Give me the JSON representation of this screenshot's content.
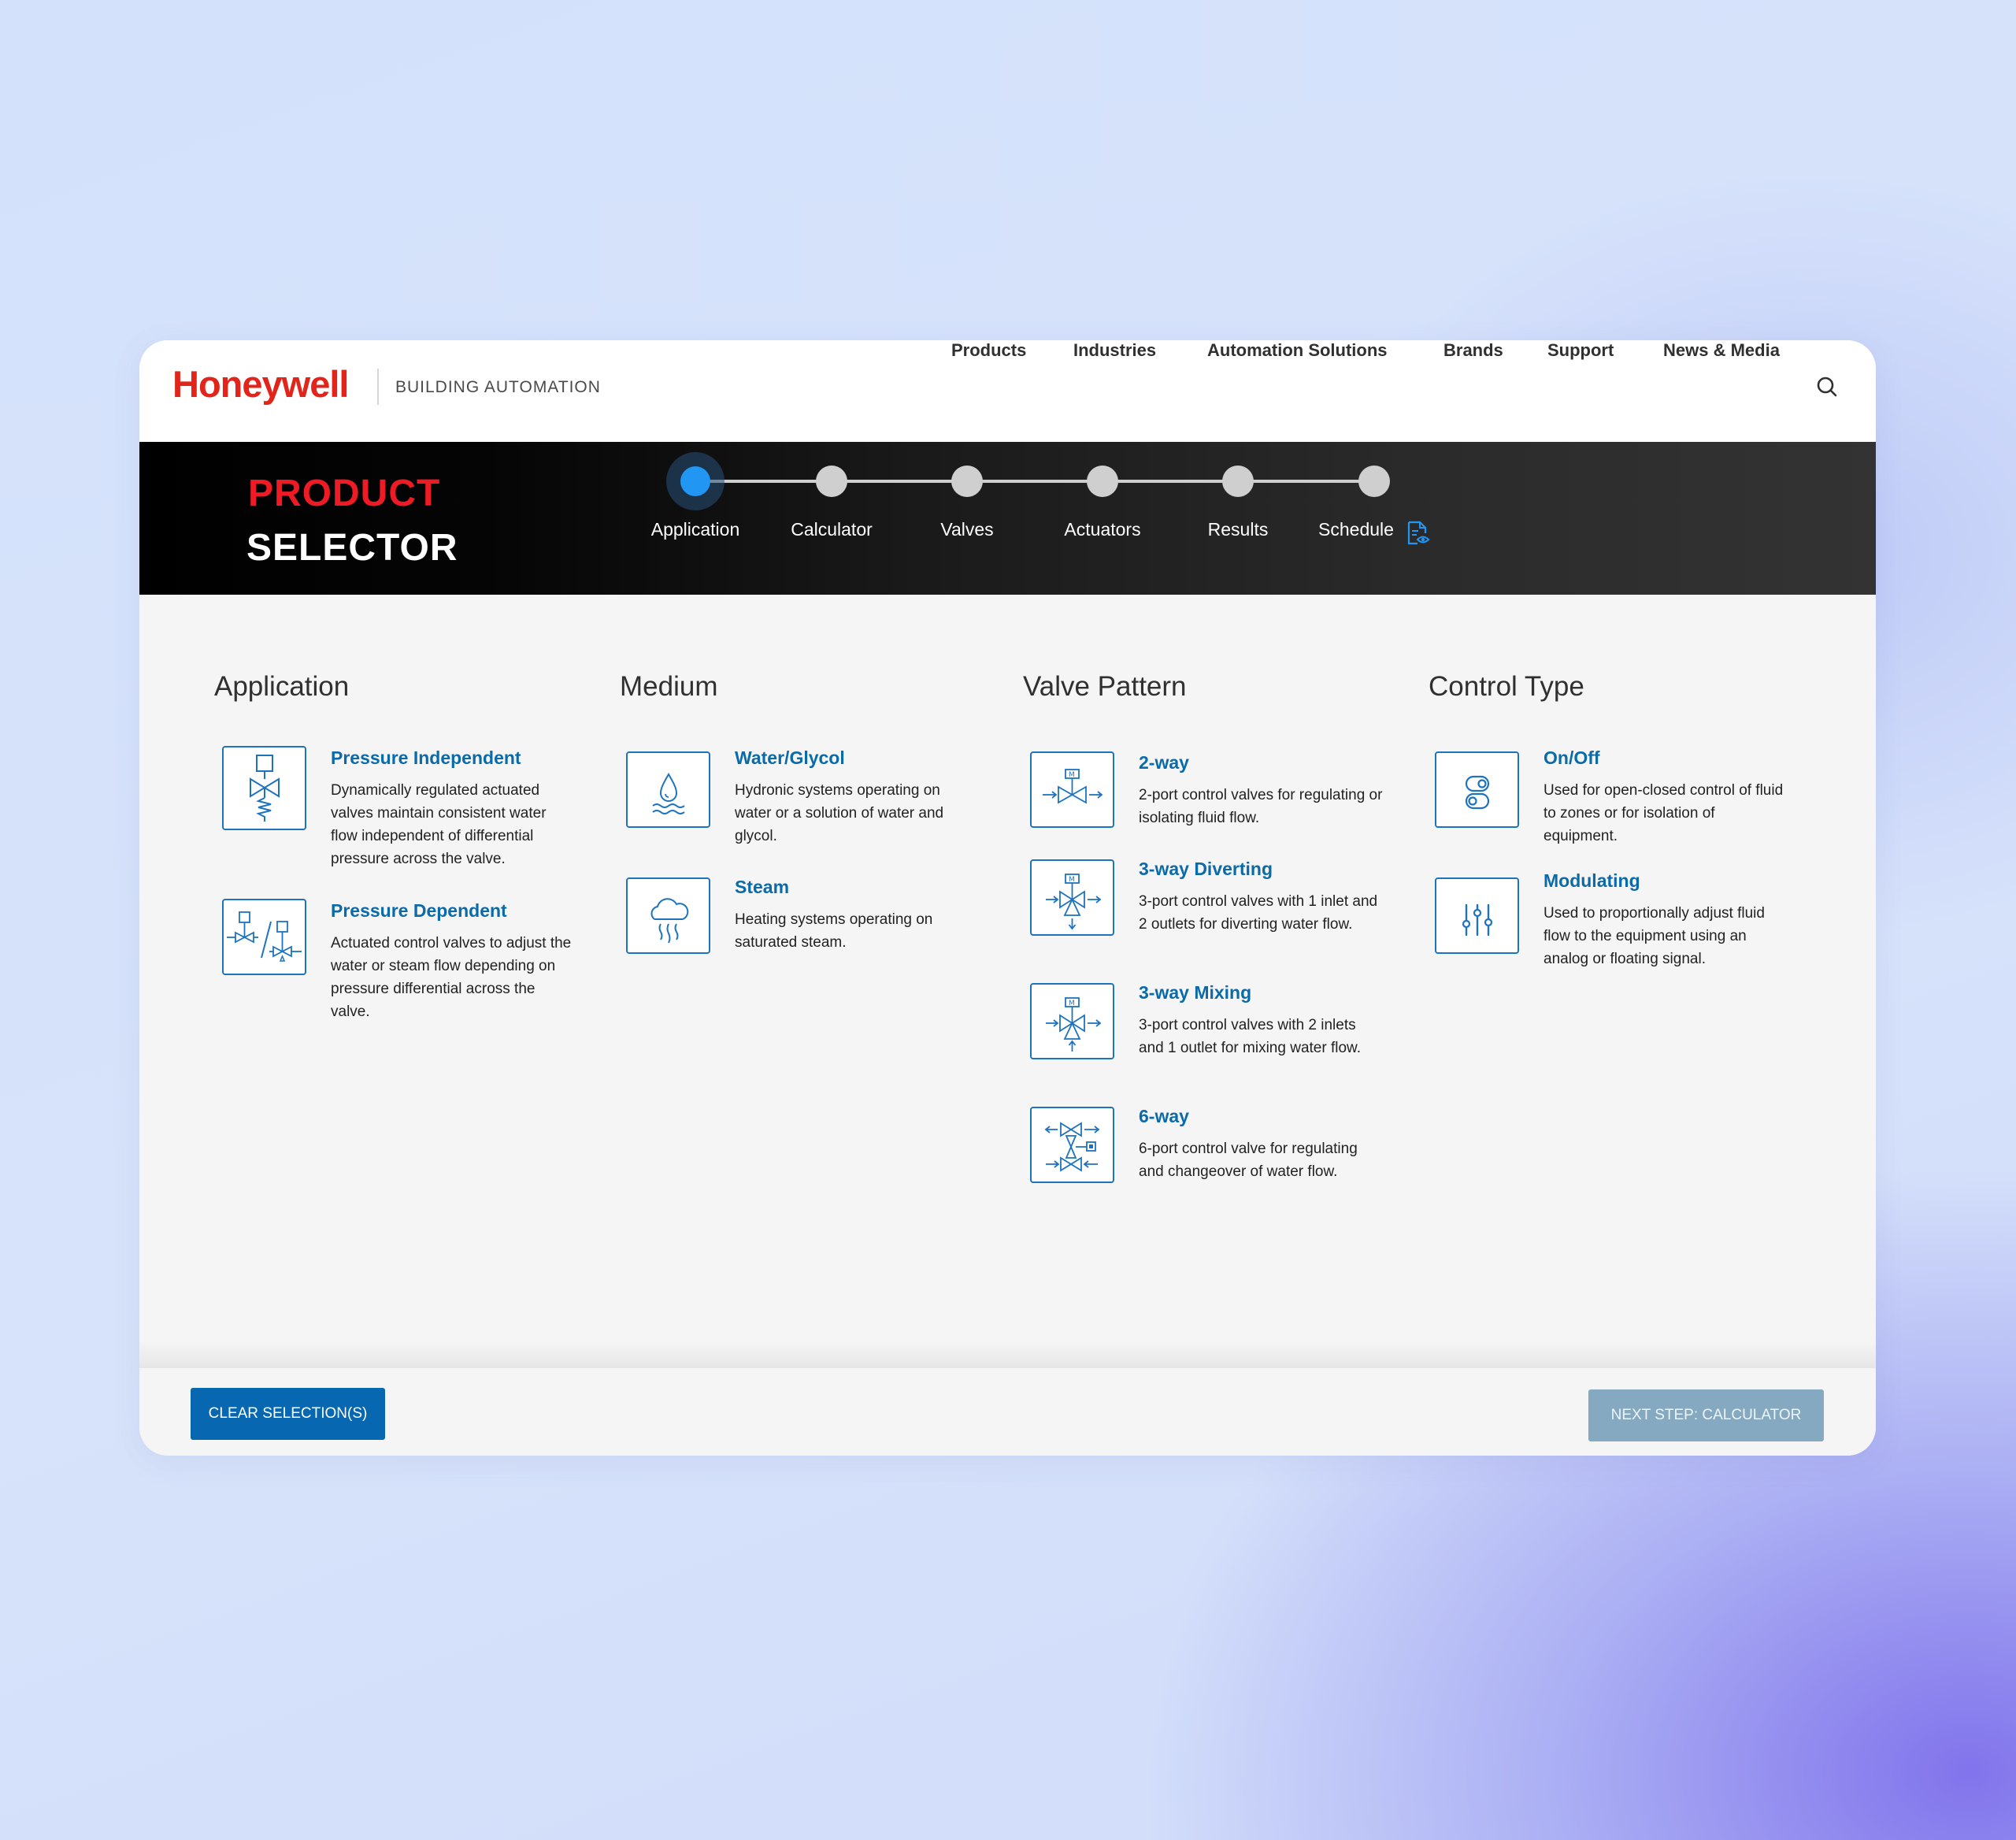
{
  "header": {
    "logo_text": "Honeywell",
    "tagline": "BUILDING AUTOMATION",
    "nav": [
      "Products",
      "Industries",
      "Automation Solutions",
      "Brands",
      "Support",
      "News & Media"
    ]
  },
  "banner": {
    "title_line1": "PRODUCT",
    "title_line2": "SELECTOR",
    "steps": [
      {
        "label": "Application",
        "active": true
      },
      {
        "label": "Calculator",
        "active": false
      },
      {
        "label": "Valves",
        "active": false
      },
      {
        "label": "Actuators",
        "active": false
      },
      {
        "label": "Results",
        "active": false
      },
      {
        "label": "Schedule",
        "active": false
      }
    ]
  },
  "columns": [
    {
      "title": "Application",
      "options": [
        {
          "title": "Pressure Independent",
          "description": "Dynamically regulated actuated valves maintain consistent water flow independent of differential pressure across the valve.",
          "icon": "pressure-independent-valve-icon"
        },
        {
          "title": "Pressure Dependent",
          "description": "Actuated control valves to adjust the water or steam flow depending on pressure differential across the valve.",
          "icon": "pressure-dependent-valve-icon"
        }
      ]
    },
    {
      "title": "Medium",
      "options": [
        {
          "title": "Water/Glycol",
          "description": "Hydronic systems operating on water or a solution of water and glycol.",
          "icon": "water-drop-icon"
        },
        {
          "title": "Steam",
          "description": "Heating systems operating on saturated steam.",
          "icon": "steam-icon"
        }
      ]
    },
    {
      "title": "Valve Pattern",
      "options": [
        {
          "title": "2-way",
          "description": "2-port control valves for regulating or isolating fluid flow.",
          "icon": "two-way-valve-icon"
        },
        {
          "title": "3-way Diverting",
          "description": "3-port control valves with 1 inlet and 2 outlets for diverting water flow.",
          "icon": "three-way-diverting-valve-icon"
        },
        {
          "title": "3-way Mixing",
          "description": "3-port control valves with 2 inlets and 1 outlet for mixing water flow.",
          "icon": "three-way-mixing-valve-icon"
        },
        {
          "title": "6-way",
          "description": "6-port control valve for regulating and changeover of water flow.",
          "icon": "six-way-valve-icon"
        }
      ]
    },
    {
      "title": "Control Type",
      "options": [
        {
          "title": "On/Off",
          "description": "Used for open-closed control of fluid to zones or for isolation of equipment.",
          "icon": "toggle-icon"
        },
        {
          "title": "Modulating",
          "description": "Used to proportionally adjust fluid flow to the equipment using an analog or floating signal.",
          "icon": "sliders-icon"
        }
      ]
    }
  ],
  "footer": {
    "clear_label": "CLEAR SELECTION(S)",
    "next_label": "NEXT STEP: CALCULATOR"
  },
  "colors": {
    "brand_red": "#e1251b",
    "accent_blue": "#0767b0",
    "active_step": "#2196f3"
  }
}
